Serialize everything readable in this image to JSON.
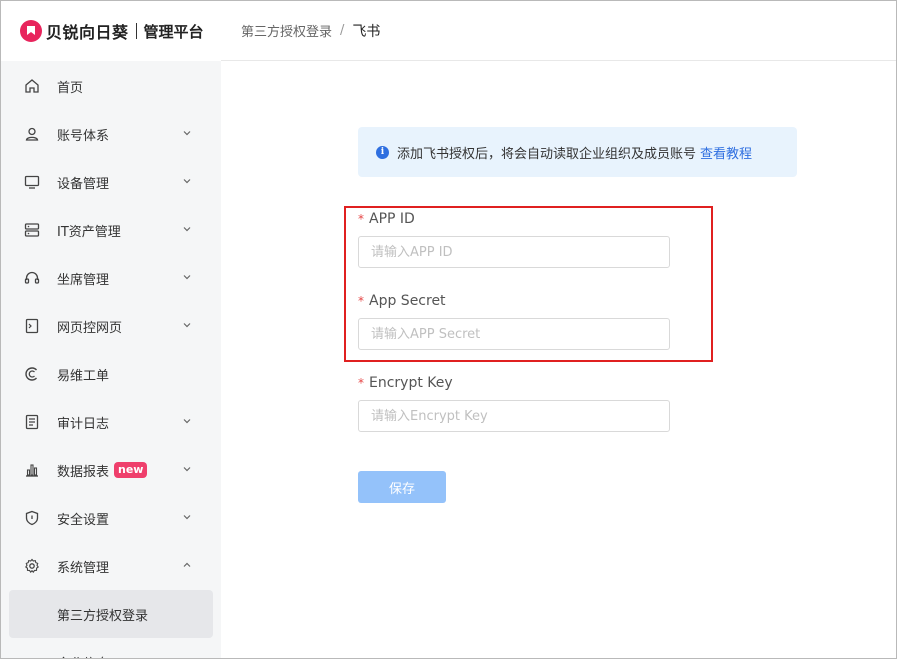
{
  "brand": {
    "name": "贝锐向日葵",
    "subtitle": "管理平台"
  },
  "breadcrumb": {
    "parent": "第三方授权登录",
    "separator": "/",
    "current": "飞书"
  },
  "sidebar": {
    "items": [
      {
        "label": "首页",
        "icon": "home-icon"
      },
      {
        "label": "账号体系",
        "icon": "user-icon"
      },
      {
        "label": "设备管理",
        "icon": "monitor-icon"
      },
      {
        "label": "IT资产管理",
        "icon": "server-icon"
      },
      {
        "label": "坐席管理",
        "icon": "headset-icon"
      },
      {
        "label": "网页控网页",
        "icon": "browser-icon"
      },
      {
        "label": "易维工单",
        "icon": "ticket-icon"
      },
      {
        "label": "审计日志",
        "icon": "log-icon"
      },
      {
        "label": "数据报表",
        "icon": "bar-chart-icon",
        "badge": "new"
      },
      {
        "label": "安全设置",
        "icon": "shield-icon"
      },
      {
        "label": "系统管理",
        "icon": "gear-icon"
      }
    ],
    "sub_items": [
      {
        "label": "第三方授权登录"
      },
      {
        "label": "企业信息"
      }
    ]
  },
  "info": {
    "text": "添加飞书授权后，将会自动读取企业组织及成员账号",
    "link": "查看教程"
  },
  "form": {
    "required_mark": "*",
    "app_id": {
      "label": "APP ID",
      "placeholder": "请输入APP ID"
    },
    "app_secret": {
      "label": "App Secret",
      "placeholder": "请输入APP Secret"
    },
    "encrypt_key": {
      "label": "Encrypt Key",
      "placeholder": "请输入Encrypt Key"
    },
    "save_label": "保存"
  },
  "colors": {
    "accent": "#2f6fe0",
    "brand": "#e8245c",
    "highlight": "#e02020",
    "save_button": "#94c2fa",
    "info_bg": "#e8f3fd"
  }
}
